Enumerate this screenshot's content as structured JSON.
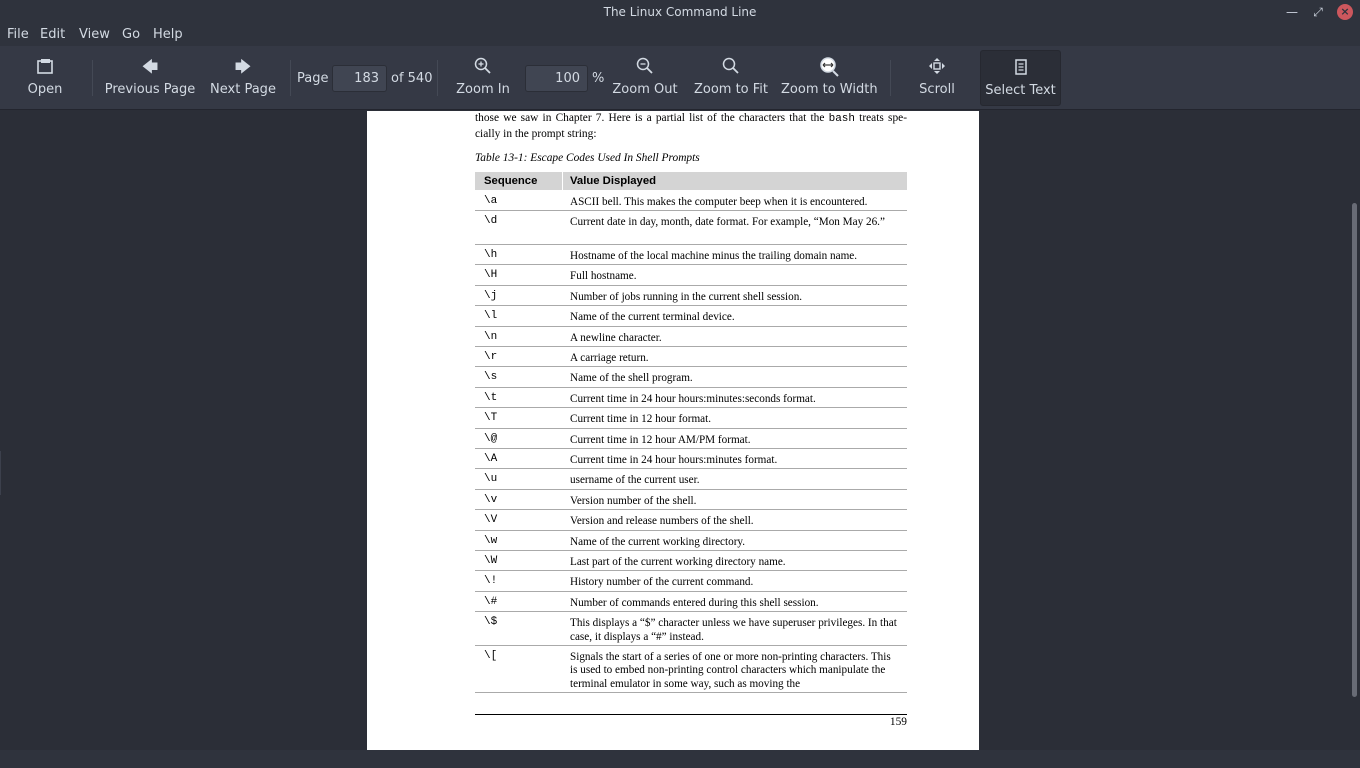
{
  "window": {
    "title": "The Linux Command Line"
  },
  "menu": {
    "items": [
      "File",
      "Edit",
      "View",
      "Go",
      "Help"
    ]
  },
  "toolbar": {
    "open": "Open",
    "previous_page": "Previous Page",
    "next_page": "Next Page",
    "page_label": "Page",
    "page_value": "183",
    "page_of": "of 540",
    "zoom_in": "Zoom In",
    "zoom_value": "100",
    "zoom_unit": "%",
    "zoom_out": "Zoom Out",
    "zoom_to_fit": "Zoom to Fit",
    "zoom_to_width": "Zoom to Width",
    "scroll": "Scroll",
    "select_text": "Select Text"
  },
  "document": {
    "intro_part1": "those we saw in Chapter 7. Here is a partial list of the characters that the ",
    "intro_mono": "bash",
    "intro_part2": " treats spe-cially in the prompt string:",
    "caption": "Table 13-1: Escape Codes Used In Shell Prompts",
    "table_headers": [
      "Sequence",
      "Value Displayed"
    ],
    "rows": [
      {
        "seq": "\\a",
        "val": "ASCII bell. This makes the computer beep when it is encountered."
      },
      {
        "seq": "\\d",
        "val": "Current date in day, month, date format. For example, “Mon May 26.”"
      },
      {
        "seq": "\\h",
        "val": "Hostname of the local machine minus the trailing domain name."
      },
      {
        "seq": "\\H",
        "val": "Full hostname."
      },
      {
        "seq": "\\j",
        "val": "Number of jobs running in the current shell session."
      },
      {
        "seq": "\\l",
        "val": "Name of the current terminal device."
      },
      {
        "seq": "\\n",
        "val": "A newline character."
      },
      {
        "seq": "\\r",
        "val": "A carriage return."
      },
      {
        "seq": "\\s",
        "val": "Name of the shell program."
      },
      {
        "seq": "\\t",
        "val": "Current time in 24 hour hours:minutes:seconds format."
      },
      {
        "seq": "\\T",
        "val": "Current time in 12 hour format."
      },
      {
        "seq": "\\@",
        "val": "Current time in 12 hour AM/PM format."
      },
      {
        "seq": "\\A",
        "val": "Current time in 24 hour hours:minutes format."
      },
      {
        "seq": "\\u",
        "val": "username of the current user."
      },
      {
        "seq": "\\v",
        "val": "Version number of the shell."
      },
      {
        "seq": "\\V",
        "val": "Version and release numbers of the shell."
      },
      {
        "seq": "\\w",
        "val": "Name of the current working directory."
      },
      {
        "seq": "\\W",
        "val": "Last part of the current working directory name."
      },
      {
        "seq": "\\!",
        "val": "History number of the current command."
      },
      {
        "seq": "\\#",
        "val": "Number of commands entered during this shell session."
      },
      {
        "seq": "\\$",
        "val": "This displays a “$” character unless we have superuser privileges. In that case, it displays a “#” instead."
      },
      {
        "seq": "\\[",
        "val": "Signals the start of a series of one or more non-printing characters. This is used to embed non-printing control characters which manipulate the terminal emulator in some way, such as moving the"
      }
    ],
    "page_number": "159"
  }
}
